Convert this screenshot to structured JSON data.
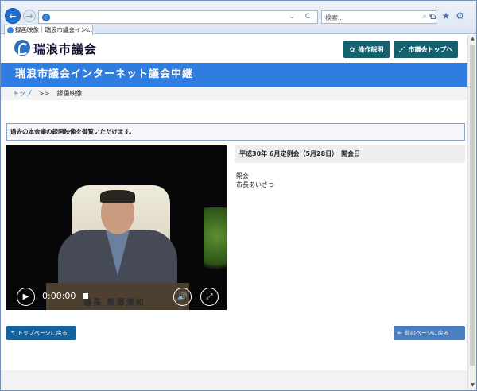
{
  "browser": {
    "back_icon": "←",
    "forward_icon": "→",
    "address_tools": "⌄ C",
    "search_placeholder": "検索...",
    "search_icon_glyph": "⌕ ▾",
    "home_icon": "⌂",
    "favorites_icon": "★",
    "settings_icon": "⚙",
    "tab_title": "録画映像｜瑞浪市議会イン...",
    "tab_close": "×"
  },
  "header": {
    "logo_text": "瑞浪市議会",
    "help_button": "操作説明",
    "help_icon": "✿",
    "council_top_button": "市議会トップへ",
    "council_top_icon": "⋰"
  },
  "banner": {
    "title": "瑞浪市議会インターネット議会中継"
  },
  "breadcrumb": {
    "top": "トップ",
    "separator": ">>",
    "current": "録画映像"
  },
  "notice": {
    "text": "過去の本会議の録画映像を御覧いただけます。"
  },
  "video": {
    "time": "0:00:00",
    "nameplate": "議長 熊澤清和",
    "play_icon": "▶",
    "volume_icon": "🔊",
    "fullscreen_icon": "⤢"
  },
  "session": {
    "heading": "平成30年 6月定例会（5月28日）　開会日",
    "items": [
      "開会",
      "市長あいさつ"
    ]
  },
  "footer": {
    "back_top_label": "トップページに戻る",
    "back_top_icon": "↰",
    "back_prev_label": "前のページに戻る",
    "back_prev_icon": "⇐"
  }
}
